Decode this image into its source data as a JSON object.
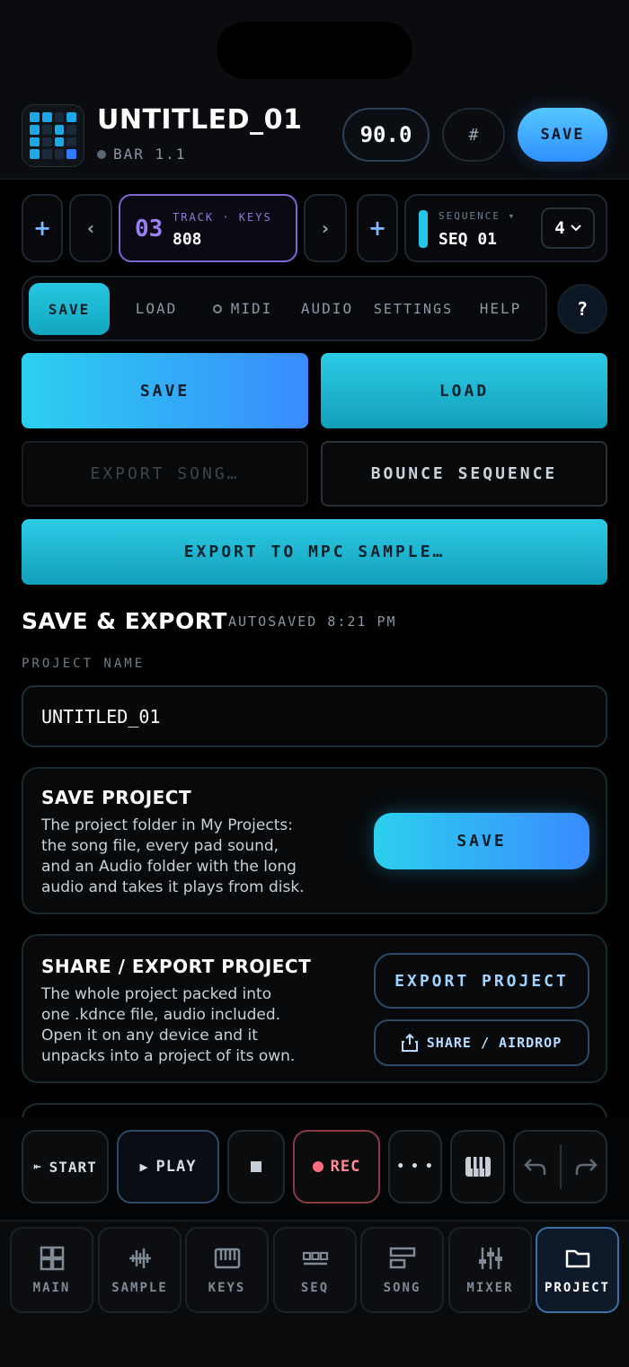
{
  "header": {
    "title": "UNTITLED_01",
    "bar_position": "BAR 1.1",
    "tempo": "90.0",
    "hash_glyph": "#",
    "save_label": "SAVE"
  },
  "track": {
    "add_left": "+",
    "prev": "‹",
    "number": "03",
    "label": "TRACK · KEYS",
    "name": "808",
    "next": "›",
    "add_right": "+"
  },
  "sequence": {
    "label": "SEQUENCE ▾",
    "name": "SEQ 01",
    "count": "4",
    "accent": "#22c6e6"
  },
  "tabs": [
    "SAVE",
    "LOAD",
    "MIDI",
    "AUDIO",
    "SETTINGS",
    "HELP"
  ],
  "help_button": "?",
  "actions": {
    "save": "SAVE",
    "load": "LOAD",
    "export_song": "EXPORT SONG…",
    "bounce": "BOUNCE SEQUENCE",
    "export_mpc": "EXPORT TO MPC SAMPLE…"
  },
  "section": {
    "title": "SAVE & EXPORT",
    "autosaved": "AUTOSAVED 8:21 PM",
    "project_name_label": "PROJECT NAME",
    "project_name_value": "UNTITLED_01"
  },
  "save_card": {
    "title": "SAVE PROJECT",
    "line1": "The project folder in My Projects:",
    "line2": "the song file, every pad sound,",
    "line3": "and an Audio folder with the long",
    "line4": "audio and takes it plays from disk.",
    "button": "SAVE"
  },
  "share_card": {
    "title": "SHARE / EXPORT PROJECT",
    "line1": "The whole project packed into",
    "line2": "one .kdnce file, audio included.",
    "line3": "Open it on any device and it",
    "line4": "unpacks into a project of its own.",
    "export_button": "EXPORT PROJECT",
    "share_button": "SHARE / AIRDROP"
  },
  "transport": {
    "start": "START",
    "start_glyph": "⇤",
    "play": "PLAY",
    "play_glyph": "▶",
    "rec": "REC",
    "more": "• • •"
  },
  "nav": [
    "MAIN",
    "SAMPLE",
    "KEYS",
    "SEQ",
    "SONG",
    "MIXER",
    "PROJECT"
  ],
  "nav_active": "PROJECT",
  "colors": {
    "accent_blue": "#3a8bff",
    "accent_teal": "#22c6e6",
    "track_purple": "#9a7ff0",
    "rec_red": "#ff6b7c"
  }
}
